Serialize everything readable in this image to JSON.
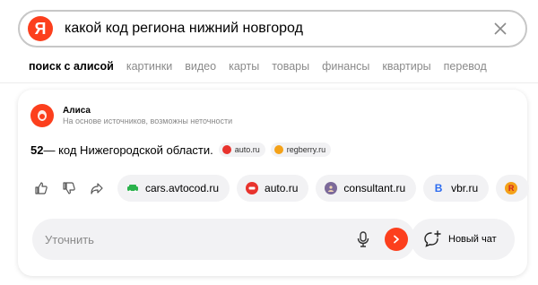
{
  "search": {
    "logo_letter": "Я",
    "query": "какой код региона нижний новгород"
  },
  "tabs": [
    {
      "label": "поиск с алисой"
    },
    {
      "label": "картинки"
    },
    {
      "label": "видео"
    },
    {
      "label": "карты"
    },
    {
      "label": "товары"
    },
    {
      "label": "финансы"
    },
    {
      "label": "квартиры"
    },
    {
      "label": "перевод"
    }
  ],
  "alisa": {
    "name": "Алиса",
    "note": "На основе источников, возможны неточности",
    "answer_number": "52",
    "answer_text": " — код Нижегородской области.",
    "inline_sources": [
      {
        "label": "auto.ru",
        "color": "#e8332d"
      },
      {
        "label": "regberry.ru",
        "color": "#f4a219"
      }
    ],
    "sources": [
      {
        "label": "cars.avtocod.ru",
        "icon": "car-icon",
        "color": "#2bb24c"
      },
      {
        "label": "auto.ru",
        "icon": "auto-ru-icon",
        "color": "#e8332d"
      },
      {
        "label": "consultant.ru",
        "icon": "consultant-icon",
        "color": "#7c6a9a"
      },
      {
        "label": "vbr.ru",
        "icon": "vbr-icon",
        "color": "#2d6cf0"
      },
      {
        "label": "",
        "icon": "regberry-icon",
        "color": "#f4a219"
      }
    ],
    "refine_placeholder": "Уточнить",
    "new_chat_label": "Новый чат"
  },
  "colors": {
    "accent": "#fc3f1d",
    "chip_bg": "#f2f2f4",
    "muted_text": "#8a8a8a"
  }
}
